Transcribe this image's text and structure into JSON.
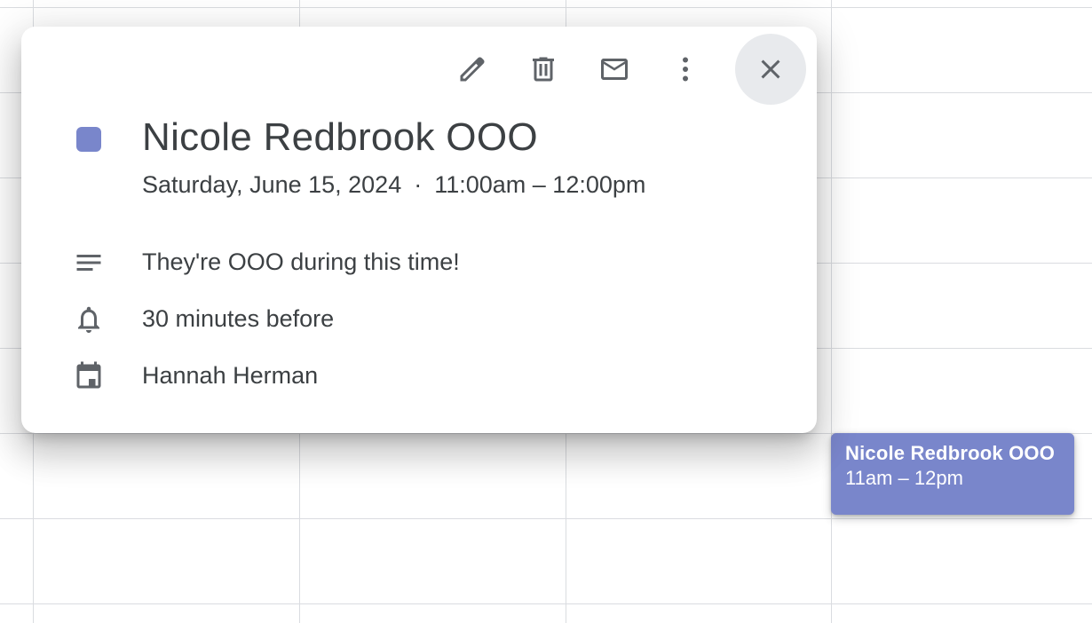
{
  "event_chip": {
    "title": "Nicole Redbrook OOO",
    "time": "11am – 12pm",
    "color": "#7986cb"
  },
  "popup": {
    "toolbar": [
      {
        "icon": "pencil-icon",
        "action": "edit"
      },
      {
        "icon": "trash-icon",
        "action": "delete"
      },
      {
        "icon": "mail-icon",
        "action": "email"
      },
      {
        "icon": "more-vert-icon",
        "action": "options"
      },
      {
        "icon": "close-icon",
        "action": "close"
      }
    ],
    "event_color": "#7986cb",
    "title": "Nicole Redbrook OOO",
    "date": "Saturday, June 15, 2024",
    "separator": "·",
    "time": "11:00am – 12:00pm",
    "details": [
      {
        "icon": "description-icon",
        "text": "They're OOO during this time!"
      },
      {
        "icon": "bell-icon",
        "text": "30 minutes before"
      },
      {
        "icon": "calendar-icon",
        "text": "Hannah Herman"
      }
    ]
  }
}
